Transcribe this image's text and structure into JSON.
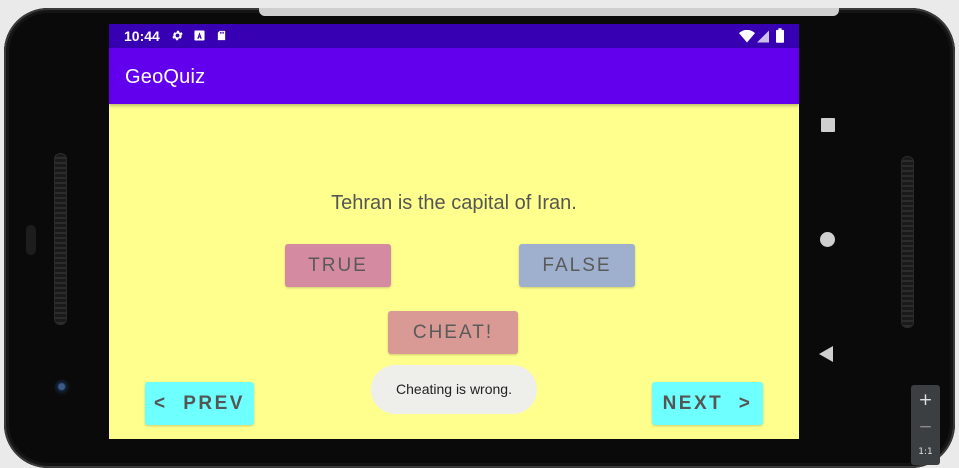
{
  "status_bar": {
    "time": "10:44",
    "left_icons": [
      "gear-icon",
      "a-icon",
      "sd-card-icon"
    ],
    "right_icons": [
      "wifi-icon",
      "signal-icon",
      "battery-icon"
    ]
  },
  "app_bar": {
    "title": "GeoQuiz",
    "color": "#6200ee"
  },
  "quiz": {
    "question": "Tehran is the capital of Iran.",
    "true_label": "TRUE",
    "false_label": "FALSE",
    "cheat_label": "CHEAT!",
    "prev_label": "<  PREV",
    "next_label": "NEXT  >"
  },
  "toast": {
    "message": "Cheating is wrong."
  },
  "emulator": {
    "zoom_in": "+",
    "zoom_out": "−",
    "zoom_ratio": "1:1"
  },
  "colors": {
    "background": "#ffff8d",
    "status_bar": "#3700b3",
    "true_button": "#d48aa0",
    "false_button": "#9fb0cf",
    "cheat_button": "#d99a96",
    "nav_button": "#6effff"
  }
}
